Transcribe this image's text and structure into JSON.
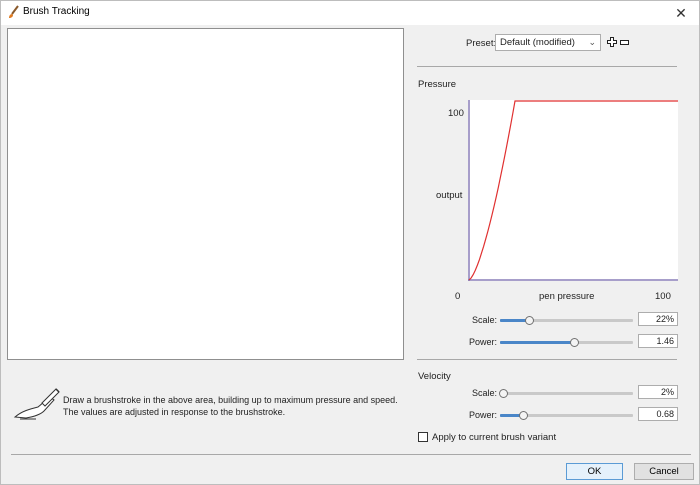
{
  "window": {
    "title": "Brush Tracking",
    "close_glyph": "✕"
  },
  "instructions": "Draw a brushstroke in the above area, building up to maximum pressure and speed. The values are adjusted in response to the brushstroke.",
  "preset": {
    "label": "Preset:",
    "value": "Default (modified)"
  },
  "pressure": {
    "label": "Pressure",
    "graph": {
      "y_top_label": "100",
      "y_label": "output",
      "x_min_label": "0",
      "x_label": "pen pressure",
      "x_max_label": "100"
    },
    "scale": {
      "label": "Scale:",
      "value": "22%",
      "fraction": 0.22
    },
    "power": {
      "label": "Power:",
      "value": "1.46",
      "fraction": 0.56
    }
  },
  "velocity": {
    "label": "Velocity",
    "scale": {
      "label": "Scale:",
      "value": "2%",
      "fraction": 0.02
    },
    "power": {
      "label": "Power:",
      "value": "0.68",
      "fraction": 0.17
    }
  },
  "apply": {
    "label": "Apply to current brush variant",
    "checked": false
  },
  "buttons": {
    "ok": "OK",
    "cancel": "Cancel"
  },
  "colors": {
    "curve": "#e03030",
    "slider_fill": "#4a86c8",
    "axis": "#8a7fb8"
  },
  "icons": [
    "brush-icon",
    "close-icon",
    "chevron-down-icon",
    "plus-icon",
    "minus-icon",
    "hand-pen-icon"
  ]
}
